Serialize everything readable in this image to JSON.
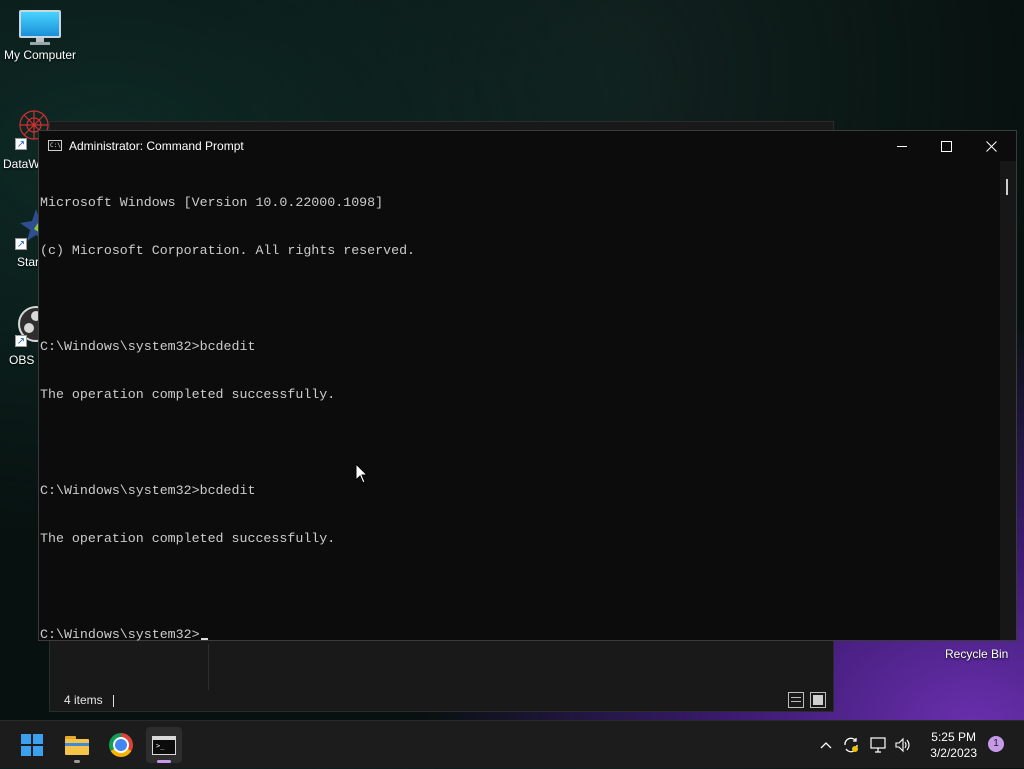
{
  "desktop": {
    "icons": [
      {
        "label": "My Computer",
        "icon": "monitor-icon"
      },
      {
        "label": "DataW",
        "icon": "datawrapper-icon"
      },
      {
        "label": "Star",
        "icon": "star-app-icon"
      },
      {
        "label": "OBS S",
        "icon": "obs-icon"
      }
    ],
    "recycle_bin_label": "Recycle Bin"
  },
  "explorer": {
    "status_text": "4 items"
  },
  "cmd": {
    "title": "Administrator: Command Prompt",
    "lines": [
      "Microsoft Windows [Version 10.0.22000.1098]",
      "(c) Microsoft Corporation. All rights reserved.",
      "",
      "C:\\Windows\\system32>bcdedit",
      "The operation completed successfully.",
      "",
      "C:\\Windows\\system32>bcdedit",
      "The operation completed successfully.",
      "",
      "C:\\Windows\\system32>"
    ],
    "controls": [
      "minimize-icon",
      "maximize-icon",
      "close-icon"
    ]
  },
  "taskbar": {
    "apps": [
      {
        "name": "Start",
        "icon": "windows-start-icon"
      },
      {
        "name": "File Explorer",
        "icon": "file-explorer-icon"
      },
      {
        "name": "Google Chrome",
        "icon": "chrome-icon"
      },
      {
        "name": "Command Prompt",
        "icon": "cmd-icon",
        "active": true
      }
    ],
    "tray_icons": [
      "chevron-up-icon",
      "sync-icon",
      "network-icon",
      "volume-icon"
    ],
    "time": "5:25 PM",
    "date": "3/2/2023",
    "notification_count": "1"
  },
  "colors": {
    "accent": "#3aa0f0",
    "console_text": "#cccccc",
    "console_bg": "#0c0c0c",
    "taskbar_bg": "#1c1c1c"
  }
}
